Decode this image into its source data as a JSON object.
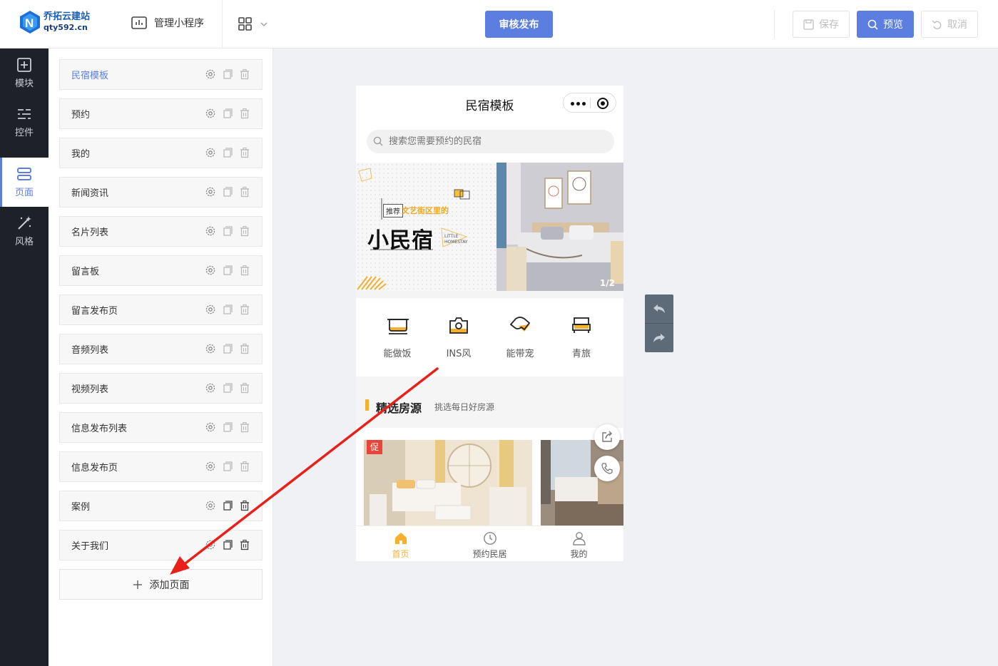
{
  "header": {
    "logo_cn": "乔拓云建站",
    "logo_en": "qty592.cn",
    "manage_label": "管理小程序",
    "publish_label": "审核发布",
    "save_label": "保存",
    "preview_label": "预览",
    "cancel_label": "取消",
    "accent_color": "#5b7ee0"
  },
  "leftnav": {
    "items": [
      {
        "label": "模块",
        "icon": "plus-square-icon"
      },
      {
        "label": "控件",
        "icon": "sliders-icon"
      },
      {
        "label": "页面",
        "icon": "pages-icon",
        "active": true
      },
      {
        "label": "风格",
        "icon": "magic-wand-icon"
      }
    ]
  },
  "pages": {
    "items": [
      {
        "label": "民宿模板",
        "active": true
      },
      {
        "label": "预约"
      },
      {
        "label": "我的"
      },
      {
        "label": "新闻资讯"
      },
      {
        "label": "名片列表"
      },
      {
        "label": "留言板"
      },
      {
        "label": "留言发布页"
      },
      {
        "label": "音频列表"
      },
      {
        "label": "视频列表"
      },
      {
        "label": "信息发布列表"
      },
      {
        "label": "信息发布页"
      },
      {
        "label": "案例"
      },
      {
        "label": "关于我们"
      }
    ],
    "add_label": "添加页面"
  },
  "phone": {
    "title": "民宿模板",
    "search_placeholder": "搜索您需要预约的民宿",
    "banner": {
      "tag": "推荐",
      "subtitle": "文艺街区里的",
      "headline": "小民宿",
      "small_text": "LITTLE HOMESTAY",
      "counter": "1/2"
    },
    "quick_items": [
      {
        "label": "能做饭",
        "icon": "pot-icon"
      },
      {
        "label": "INS风",
        "icon": "camera-icon"
      },
      {
        "label": "能带宠",
        "icon": "pet-icon"
      },
      {
        "label": "青旅",
        "icon": "bed-icon"
      }
    ],
    "section": {
      "title": "精选房源",
      "subtitle": "挑选每日好房源"
    },
    "promo_label": "促",
    "tabs": [
      {
        "label": "首页",
        "icon": "home-icon",
        "active": true
      },
      {
        "label": "预约民居",
        "icon": "clock-icon"
      },
      {
        "label": "我的",
        "icon": "user-icon"
      }
    ],
    "accent_color": "#f5b02e"
  }
}
